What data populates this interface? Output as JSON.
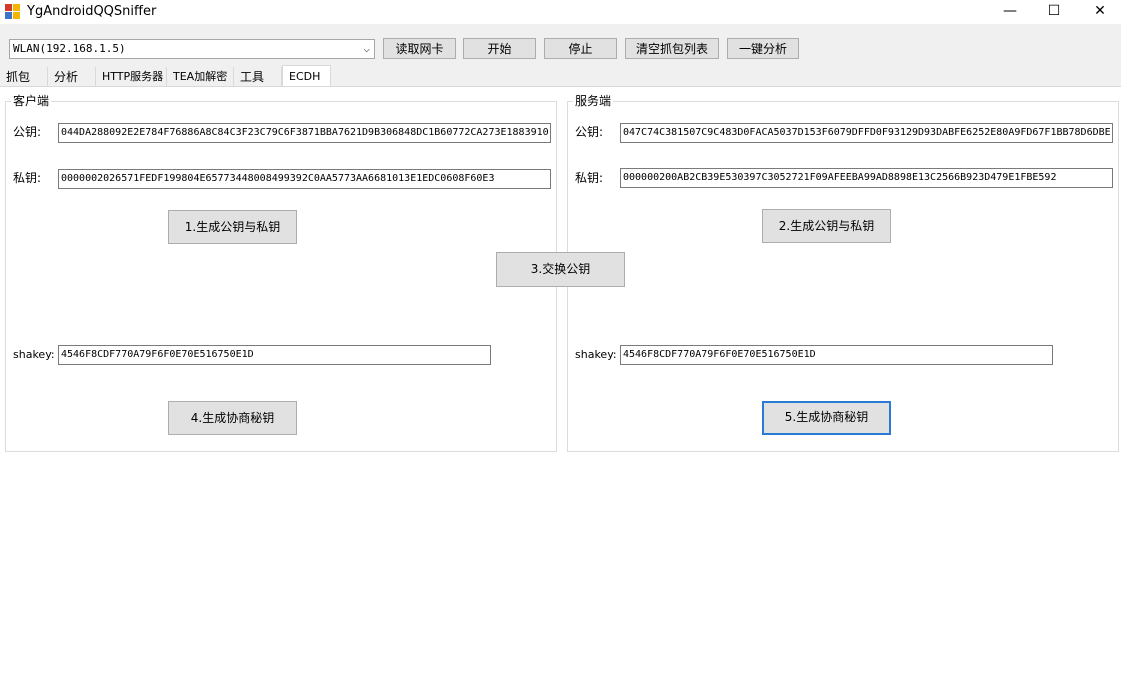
{
  "window": {
    "title": "YgAndroidQQSniffer",
    "minimize": "—",
    "maximize": "☐",
    "close": "✕"
  },
  "toolbar": {
    "nic_select_value": "WLAN(192.168.1.5)",
    "read_nic_label": "读取网卡",
    "start_label": "开始",
    "stop_label": "停止",
    "clear_label": "清空抓包列表",
    "analyze_label": "一键分析"
  },
  "tabs": [
    {
      "label": "抓包"
    },
    {
      "label": "分析"
    },
    {
      "label": "HTTP服务器"
    },
    {
      "label": "TEA加解密"
    },
    {
      "label": "工具"
    },
    {
      "label": "ECDH"
    }
  ],
  "client": {
    "title": "客户端",
    "public_key_label": "公钥:",
    "public_key_value": "044DA288092E2E784F76886A8C84C3F23C79C6F3871BBA7621D9B306848DC1B60772CA273E1883910",
    "private_key_label": "私钥:",
    "private_key_value": "0000002026571FEDF199804E65773448008499392C0AA5773AA6681013E1EDC0608F60E3",
    "gen_button": "1.生成公钥与私钥",
    "shakey_label": "shakey:",
    "shakey_value": "4546F8CDF770A79F6F0E70E516750E1D",
    "gen_shared_button": "4.生成协商秘钥"
  },
  "server": {
    "title": "服务端",
    "public_key_label": "公钥:",
    "public_key_value": "047C74C381507C9C483D0FACA5037D153F6079DFFD0F93129D93DABFE6252E80A9FD67F1BB78D6DBE",
    "private_key_label": "私钥:",
    "private_key_value": "000000200AB2CB39E530397C3052721F09AFEEBA99AD8898E13C2566B923D479E1FBE592",
    "gen_button": "2.生成公钥与私钥",
    "shakey_label": "shakey:",
    "shakey_value": "4546F8CDF770A79F6F0E70E516750E1D",
    "gen_shared_button": "5.生成协商秘钥"
  },
  "exchange_button": "3.交换公钥"
}
